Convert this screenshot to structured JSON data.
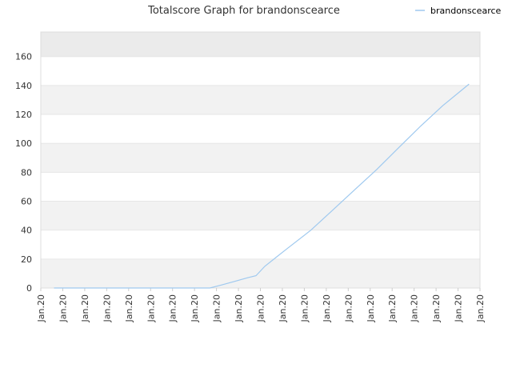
{
  "chart_data": {
    "type": "line",
    "title": "Totalscore Graph for brandonscearce",
    "xlabel": "",
    "ylabel": "",
    "x_tick_labels": [
      "Jan.20",
      "Jan.20",
      "Jan.20",
      "Jan.20",
      "Jan.20",
      "Jan.20",
      "Jan.20",
      "Jan.20",
      "Jan.20",
      "Jan.20",
      "Jan.20",
      "Jan.20",
      "Jan.20",
      "Jan.20",
      "Jan.20",
      "Jan.20",
      "Jan.20",
      "Jan.20",
      "Jan.20",
      "Jan.20",
      "Jan.20"
    ],
    "y_ticks": [
      0,
      20,
      40,
      60,
      80,
      100,
      120,
      140,
      160
    ],
    "ylim": [
      0,
      177
    ],
    "xlim": [
      0,
      20
    ],
    "grid": true,
    "legend_position": "top-right",
    "colors": {
      "line": "#9fc9ef",
      "band_alt": "#f2f2f2",
      "band_top": "#ebebeb",
      "axis": "#dddddd"
    },
    "series": [
      {
        "name": "brandonscearce",
        "x": [
          0.6,
          7.7,
          8.2,
          8.8,
          9.4,
          9.8,
          10.2,
          10.7,
          11.2,
          12.3,
          13.3,
          14.3,
          15.3,
          16.3,
          17.3,
          18.3,
          19.5
        ],
        "y": [
          0,
          0,
          2,
          4.5,
          7,
          8.5,
          15,
          21,
          27,
          40,
          54,
          68,
          82,
          97,
          112,
          126,
          141
        ]
      }
    ]
  }
}
